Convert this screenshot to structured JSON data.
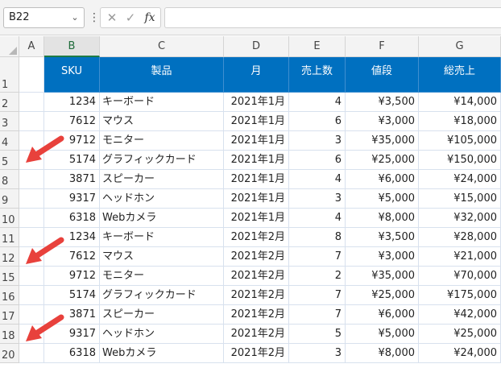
{
  "formula_bar": {
    "name_box": "B22",
    "formula": ""
  },
  "columns": [
    "A",
    "B",
    "C",
    "D",
    "E",
    "F",
    "G"
  ],
  "selected_column": "B",
  "header_row": {
    "row_number": "1",
    "cells": [
      "SKU",
      "製品",
      "月",
      "売上数",
      "値段",
      "総売上"
    ]
  },
  "rows": [
    {
      "n": "2",
      "sku": "1234",
      "product": "キーボード",
      "month": "2021年1月",
      "qty": "4",
      "price": "¥3,500",
      "total": "¥14,000"
    },
    {
      "n": "3",
      "sku": "7612",
      "product": "マウス",
      "month": "2021年1月",
      "qty": "6",
      "price": "¥3,000",
      "total": "¥18,000"
    },
    {
      "n": "4",
      "sku": "9712",
      "product": "モニター",
      "month": "2021年1月",
      "qty": "3",
      "price": "¥35,000",
      "total": "¥105,000"
    },
    {
      "n": "5",
      "sku": "5174",
      "product": "グラフィックカード",
      "month": "2021年1月",
      "qty": "6",
      "price": "¥25,000",
      "total": "¥150,000"
    },
    {
      "n": "8",
      "sku": "3871",
      "product": "スピーカー",
      "month": "2021年1月",
      "qty": "4",
      "price": "¥6,000",
      "total": "¥24,000"
    },
    {
      "n": "9",
      "sku": "9317",
      "product": "ヘッドホン",
      "month": "2021年1月",
      "qty": "3",
      "price": "¥5,000",
      "total": "¥15,000"
    },
    {
      "n": "10",
      "sku": "6318",
      "product": "Webカメラ",
      "month": "2021年1月",
      "qty": "4",
      "price": "¥8,000",
      "total": "¥32,000"
    },
    {
      "n": "11",
      "sku": "1234",
      "product": "キーボード",
      "month": "2021年2月",
      "qty": "8",
      "price": "¥3,500",
      "total": "¥28,000"
    },
    {
      "n": "12",
      "sku": "7612",
      "product": "マウス",
      "month": "2021年2月",
      "qty": "7",
      "price": "¥3,000",
      "total": "¥21,000"
    },
    {
      "n": "15",
      "sku": "9712",
      "product": "モニター",
      "month": "2021年2月",
      "qty": "2",
      "price": "¥35,000",
      "total": "¥70,000"
    },
    {
      "n": "16",
      "sku": "5174",
      "product": "グラフィックカード",
      "month": "2021年2月",
      "qty": "7",
      "price": "¥25,000",
      "total": "¥175,000"
    },
    {
      "n": "17",
      "sku": "3871",
      "product": "スピーカー",
      "month": "2021年2月",
      "qty": "7",
      "price": "¥6,000",
      "total": "¥42,000"
    },
    {
      "n": "18",
      "sku": "9317",
      "product": "ヘッドホン",
      "month": "2021年2月",
      "qty": "5",
      "price": "¥5,000",
      "total": "¥25,000"
    },
    {
      "n": "20",
      "sku": "6318",
      "product": "Webカメラ",
      "month": "2021年2月",
      "qty": "3",
      "price": "¥8,000",
      "total": "¥24,000"
    }
  ],
  "colors": {
    "header_fill": "#0070c0",
    "arrow": "#e8413c",
    "selected_column_accent": "#1e7b45"
  },
  "icons": {
    "cancel": "close-icon",
    "confirm": "check-icon",
    "function": "fx-icon",
    "namebox_dropdown": "chevron-down-icon",
    "more": "vertical-dots-icon"
  }
}
